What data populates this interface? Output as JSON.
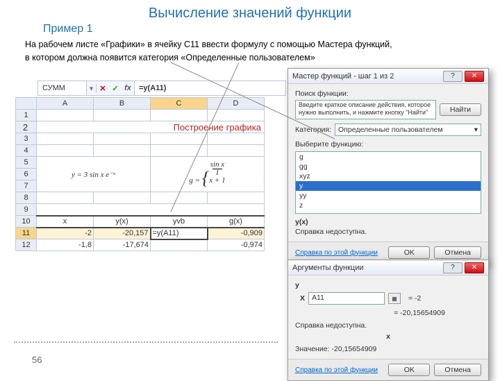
{
  "slide": {
    "title": "Вычисление значений функции",
    "example": "Пример 1",
    "instruction_line1": "На рабочем листе «Графики» в ячейку С11 ввести формулу с помощью Мастера функций,",
    "instruction_line2": "в котором должна появится категория «Определенные пользователем»",
    "page_number": "56"
  },
  "formula_bar": {
    "name_box": "СУММ",
    "formula": "=y(A11)"
  },
  "grid": {
    "cols": [
      "A",
      "B",
      "C",
      "D"
    ],
    "sheet_title": "Построение графика",
    "eq_y": "y = 3 sin x e⁻ˣ",
    "eq_g_top": "sin x",
    "eq_g_bot": "1",
    "eq_g_den": "x + 1",
    "headers": [
      "x",
      "y(x)",
      "yvb",
      "g(x)"
    ],
    "row11": {
      "a": "-2",
      "b": "-20,157",
      "c": "=y(A11)",
      "d": "-0,909"
    },
    "row12": {
      "a": "-1,8",
      "b": "-17,674",
      "c": "",
      "d": "-0,974",
      "e": "-("
    }
  },
  "wizard": {
    "title": "Мастер функций - шаг 1 из 2",
    "search_label": "Поиск функции:",
    "search_text": "Введите краткое описание действия, которое нужно выполнить, и нажмите кнопку \"Найти\"",
    "find_btn": "Найти",
    "category_label": "Категория:",
    "category_value": "Определенные пользователем",
    "select_label": "Выберите функцию:",
    "functions": [
      "g",
      "gg",
      "xyz",
      "y",
      "yy",
      "z"
    ],
    "selected_sig": "y(x)",
    "help_text": "Справка недоступна.",
    "help_link": "Справка по этой функции",
    "ok": "OK",
    "cancel": "Отмена"
  },
  "args": {
    "title": "Аргументы функции",
    "func_name": "y",
    "arg_label": "X",
    "arg_value": "A11",
    "arg_eval": "= -2",
    "result_eval": "= -20,15654909",
    "help_text": "Справка недоступна.",
    "arg_name_bold": "x",
    "value_label": "Значение:",
    "value": "-20,15654909",
    "help_link": "Справка по этой функции",
    "ok": "OK",
    "cancel": "Отмена"
  }
}
